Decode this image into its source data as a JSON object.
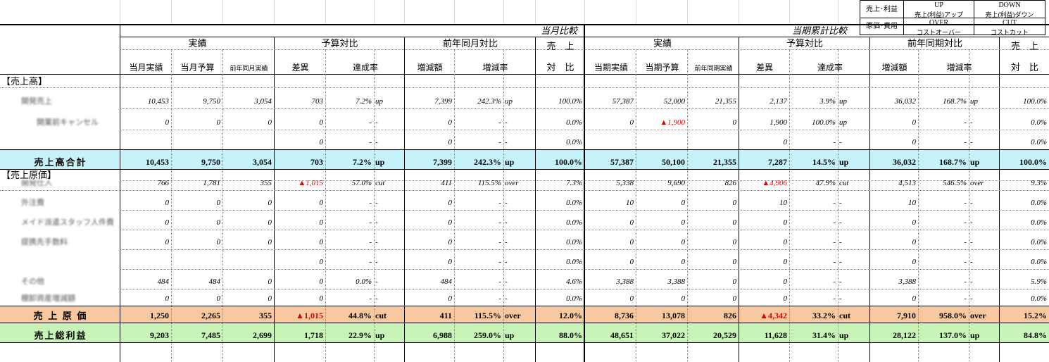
{
  "legend": {
    "row1_label": "売上･利益",
    "row2_label": "原価･費用",
    "up_code": "UP",
    "up_desc": "売上(利益)アップ",
    "down_code": "DOWN",
    "down_desc": "売上(利益)ダウン",
    "over_code": "OVER",
    "over_desc": "コストオーバー",
    "cut_code": "CUT",
    "cut_desc": "コストカット"
  },
  "headers": {
    "monthly_group": "当月比較",
    "cumulative_group": "当期累計比較",
    "m_actual": "実績",
    "m_budget_compare": "予算対比",
    "m_yoy_compare": "前年同月対比",
    "m_sales_ratio_1": "売　上",
    "m_sales_ratio_2": "対　比",
    "c_actual": "実績",
    "c_budget_compare": "予算対比",
    "c_yoy_compare": "前年同期対比",
    "c_sales_ratio_1": "売　上",
    "c_sales_ratio_2": "対　比",
    "sub": [
      "当月実績",
      "当月予算",
      "前年同月実績",
      "差異",
      "達成率",
      "増減額",
      "増減率",
      "当期実績",
      "当期予算",
      "前年同期実績",
      "差異",
      "達成率",
      "増減額",
      "増減率"
    ]
  },
  "sections": {
    "sales": "【売上高】",
    "cost": "【売上原価】"
  },
  "rows": [
    {
      "label": "開発売上",
      "v": [
        "10,453",
        "9,750",
        "3,054",
        "703",
        "7.2%",
        "up",
        "7,399",
        "242.3%",
        "up",
        "100.0%",
        "57,387",
        "52,000",
        "21,355",
        "2,137",
        "3.9%",
        "up",
        "36,032",
        "168.7%",
        "up",
        "100.0%"
      ]
    },
    {
      "label": "　　開業前キャンセル",
      "v": [
        "0",
        "0",
        "0",
        "0",
        "-",
        "-",
        "0",
        "-",
        "-",
        "0.0%",
        "0",
        "▲1,900",
        "0",
        "1,900",
        "100.0%",
        "up",
        "0",
        "-",
        "-",
        "0.0%"
      ]
    },
    {
      "label": "",
      "v": [
        "",
        "",
        "",
        "0",
        "-",
        "-",
        "0",
        "-",
        "-",
        "0.0%",
        "",
        "",
        "",
        "0",
        "-",
        "-",
        "0",
        "-",
        "-",
        "0.0%"
      ]
    },
    {
      "label": "売上高合計",
      "v": [
        "10,453",
        "9,750",
        "3,054",
        "703",
        "7.2%",
        "up",
        "7,399",
        "242.3%",
        "up",
        "100.0%",
        "57,387",
        "50,100",
        "21,355",
        "7,287",
        "14.5%",
        "up",
        "36,032",
        "168.7%",
        "up",
        "100.0%"
      ]
    },
    {
      "label": "開発仕入",
      "v": [
        "766",
        "1,781",
        "355",
        "▲1,015",
        "57.0%",
        "cut",
        "411",
        "115.5%",
        "over",
        "7.3%",
        "5,338",
        "9,690",
        "826",
        "▲4,906",
        "47.9%",
        "cut",
        "4,513",
        "546.5%",
        "over",
        "9.3%"
      ]
    },
    {
      "label": "外注費",
      "v": [
        "0",
        "0",
        "0",
        "0",
        "-",
        "-",
        "0",
        "-",
        "-",
        "0.0%",
        "10",
        "0",
        "0",
        "10",
        "-",
        "-",
        "10",
        "-",
        "-",
        "0.0%"
      ]
    },
    {
      "label": "メイド派遣スタッフ人件費",
      "v": [
        "0",
        "0",
        "0",
        "0",
        "-",
        "-",
        "0",
        "-",
        "-",
        "0.0%",
        "0",
        "0",
        "0",
        "0",
        "-",
        "-",
        "0",
        "-",
        "-",
        "0.0%"
      ]
    },
    {
      "label": "提携先手数料",
      "v": [
        "0",
        "0",
        "0",
        "0",
        "-",
        "-",
        "0",
        "-",
        "-",
        "0.0%",
        "0",
        "0",
        "0",
        "0",
        "-",
        "-",
        "0",
        "-",
        "-",
        "0.0%"
      ]
    },
    {
      "label": "",
      "v": [
        "",
        "",
        "",
        "0",
        "-",
        "-",
        "0",
        "-",
        "-",
        "0.0%",
        "0",
        "0",
        "0",
        "0",
        "-",
        "-",
        "0",
        "-",
        "-",
        "0.0%"
      ]
    },
    {
      "label": "その他",
      "v": [
        "484",
        "484",
        "0",
        "0",
        "0.0%",
        "-",
        "484",
        "-",
        "-",
        "4.6%",
        "3,388",
        "3,388",
        "0",
        "0",
        "-",
        "-",
        "3,388",
        "-",
        "-",
        "5.9%"
      ]
    },
    {
      "label": "棚卸資産増減額",
      "v": [
        "0",
        "0",
        "0",
        "0",
        "-",
        "-",
        "0",
        "-",
        "-",
        "0.0%",
        "0",
        "0",
        "0",
        "0",
        "-",
        "-",
        "0",
        "-",
        "-",
        "0.0%"
      ]
    },
    {
      "label": "売 上 原 価",
      "v": [
        "1,250",
        "2,265",
        "355",
        "▲1,015",
        "44.8%",
        "cut",
        "411",
        "115.5%",
        "over",
        "12.0%",
        "8,736",
        "13,078",
        "826",
        "▲4,342",
        "33.2%",
        "cut",
        "7,910",
        "958.0%",
        "over",
        "15.2%"
      ]
    },
    {
      "label": "売上総利益",
      "v": [
        "9,203",
        "7,485",
        "2,699",
        "1,718",
        "22.9%",
        "up",
        "6,988",
        "259.0%",
        "up",
        "88.0%",
        "48,651",
        "37,022",
        "20,529",
        "11,628",
        "31.4%",
        "up",
        "28,122",
        "137.0%",
        "up",
        "84.8%"
      ]
    }
  ],
  "colors": {
    "total_sales_bg": "#c6f3fb",
    "cost_total_bg": "#f8c9a1",
    "gross_profit_bg": "#c9f4b7",
    "negative": "#e00000"
  }
}
